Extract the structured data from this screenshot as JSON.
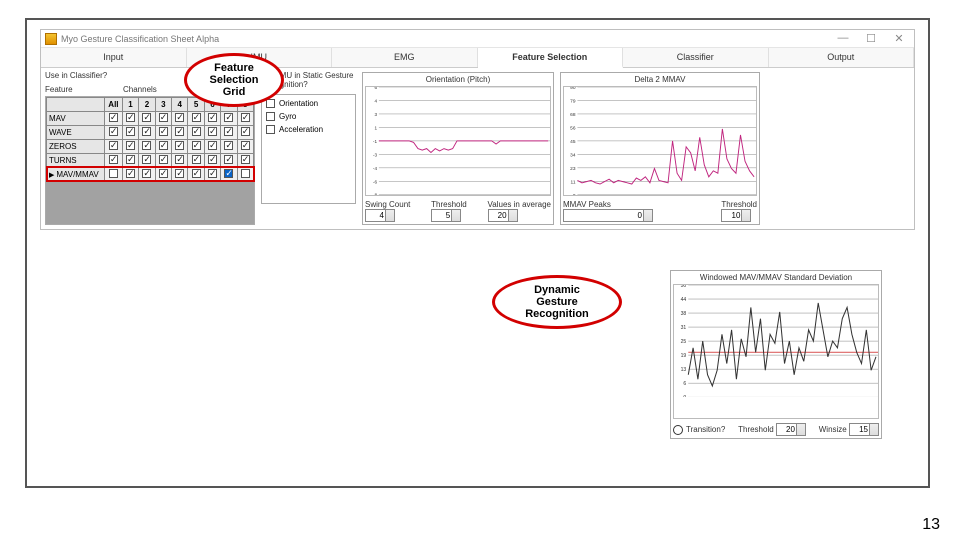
{
  "window": {
    "title": "Myo Gesture Classification Sheet Alpha"
  },
  "tabs": [
    "Input",
    "IMU",
    "EMG",
    "Feature Selection",
    "Classifier",
    "Output"
  ],
  "active_tab": "Feature Selection",
  "left": {
    "use_label": "Use in Classifier?",
    "feature_label": "Feature",
    "channels_label": "Channels",
    "cols": [
      "All",
      "1",
      "2",
      "3",
      "4",
      "5",
      "6",
      "7",
      "8"
    ],
    "rows": [
      {
        "name": "MAV",
        "checks": [
          1,
          1,
          1,
          1,
          1,
          1,
          1,
          1,
          1
        ]
      },
      {
        "name": "WAVE",
        "checks": [
          1,
          1,
          1,
          1,
          1,
          1,
          1,
          1,
          1
        ]
      },
      {
        "name": "ZEROS",
        "checks": [
          1,
          1,
          1,
          1,
          1,
          1,
          1,
          1,
          1
        ]
      },
      {
        "name": "TURNS",
        "checks": [
          1,
          1,
          1,
          1,
          1,
          1,
          1,
          1,
          1
        ]
      },
      {
        "name": "MAV/MMAV",
        "checks": [
          0,
          1,
          1,
          1,
          1,
          1,
          1,
          1,
          0
        ],
        "selected": true,
        "highlight": true,
        "blue_idx": 7
      }
    ]
  },
  "imu": {
    "label": "Use IMU in Static Gesture Recognition?",
    "items": [
      {
        "label": "Orientation",
        "on": false
      },
      {
        "label": "Gyro",
        "on": false
      },
      {
        "label": "Acceleration",
        "on": false
      }
    ]
  },
  "chart_orientation": {
    "title": "Orientation (Pitch)",
    "controls": {
      "swing_label": "Swing Count",
      "swing": "4",
      "thresh_label": "Threshold",
      "thresh": "5",
      "avg_label": "Values in average",
      "avg": "20"
    }
  },
  "chart_delta": {
    "title": "Delta 2 MMAV",
    "controls": {
      "peaks_label": "MMAV Peaks",
      "peaks": "0",
      "thresh_label": "Threshold",
      "thresh": "10"
    }
  },
  "chart_window": {
    "title": "Windowed MAV/MMAV Standard Deviation",
    "controls": {
      "trans_label": "Transition?",
      "thresh_label": "Threshold",
      "thresh": "20",
      "win_label": "Winsize",
      "win": "15"
    }
  },
  "annotations": {
    "a1": "Feature\nSelection\nGrid",
    "a2": "Dynamic\nGesture\nRecognition"
  },
  "page": "13",
  "chart_data": [
    {
      "type": "line",
      "title": "Orientation (Pitch)",
      "ylim": [
        -8,
        6
      ],
      "x_range": [
        0,
        200
      ],
      "series": [
        {
          "name": "pitch",
          "color": "#c0267f",
          "values": [
            -1,
            -1,
            -1,
            -1,
            -1,
            -1,
            -1,
            -1,
            -1.2,
            -2,
            -2.2,
            -2,
            -2.5,
            -2,
            -2.3,
            -2,
            -2.2,
            -2,
            -1,
            -1,
            -1,
            -1,
            -1,
            -1,
            -1,
            -1,
            -1,
            -1.4,
            -1,
            -1,
            -1,
            -1,
            -1,
            -1,
            -1,
            -1,
            -1,
            -1,
            -1,
            -1
          ]
        }
      ]
    },
    {
      "type": "line",
      "title": "Delta 2 MMAV",
      "ylim": [
        0,
        90
      ],
      "x_range": [
        0,
        200
      ],
      "series": [
        {
          "name": "delta",
          "color": "#c0267f",
          "values": [
            12,
            10,
            11,
            12,
            10,
            9,
            11,
            13,
            10,
            12,
            11,
            10,
            9,
            14,
            12,
            15,
            10,
            22,
            12,
            11,
            10,
            45,
            18,
            12,
            40,
            35,
            20,
            48,
            25,
            15,
            20,
            18,
            55,
            30,
            22,
            18,
            50,
            28,
            20,
            15
          ]
        }
      ]
    },
    {
      "type": "line",
      "title": "Windowed MAV/MMAV Standard Deviation",
      "ylim": [
        0,
        50
      ],
      "x_range": [
        0,
        200
      ],
      "threshold": 20,
      "series": [
        {
          "name": "std",
          "color": "#333",
          "values": [
            10,
            22,
            8,
            25,
            10,
            5,
            12,
            28,
            15,
            30,
            8,
            26,
            18,
            40,
            20,
            35,
            12,
            28,
            24,
            38,
            15,
            25,
            10,
            22,
            16,
            30,
            25,
            42,
            30,
            18,
            25,
            22,
            35,
            40,
            28,
            20,
            15,
            30,
            12,
            18
          ]
        }
      ]
    }
  ]
}
